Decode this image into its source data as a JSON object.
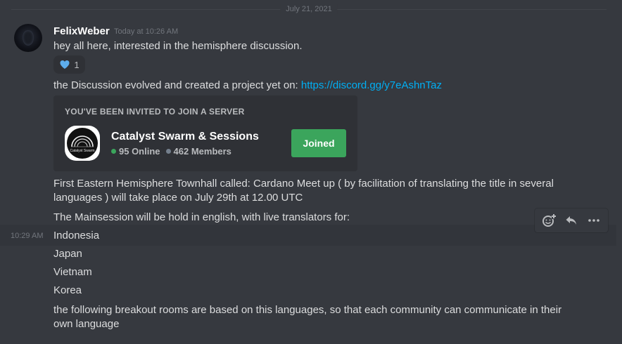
{
  "divider": {
    "date": "July 21, 2021"
  },
  "message": {
    "username": "FelixWeber",
    "timestamp": "Today at 10:26 AM",
    "text1": "hey all here, interested in the hemisphere discussion.",
    "reaction": {
      "emoji": "blue-heart-icon",
      "count": "1"
    },
    "text2_prefix": "the Discussion evolved and created a project yet on: ",
    "text2_link": "https://discord.gg/y7eAshnTaz",
    "invite": {
      "heading": "YOU'VE BEEN INVITED TO JOIN A SERVER",
      "server_name": "Catalyst Swarm & Sessions",
      "online": "95 Online",
      "members": "462 Members",
      "button_label": "Joined",
      "icon_text": "Catalyst Swarm"
    },
    "text3_line1": "First Eastern Hemisphere Townhall called: Cardano Meet up ( by facilitation of translating the title in several",
    "text3_line2": "languages ) will take place on July 29th at 12.00 UTC",
    "text4": "The Mainsession will be hold in english, with live translators for:",
    "hover_time": "10:29 AM",
    "languages": [
      "Indonesia",
      "Japan",
      "Vietnam",
      "Korea"
    ],
    "text5_line1": "the following breakout rooms are based on this languages, so that each community can communicate in their",
    "text5_line2": "own language"
  },
  "colors": {
    "background": "#36393f",
    "link": "#00aff4",
    "joined": "#3ba55c",
    "card": "#2f3136"
  }
}
